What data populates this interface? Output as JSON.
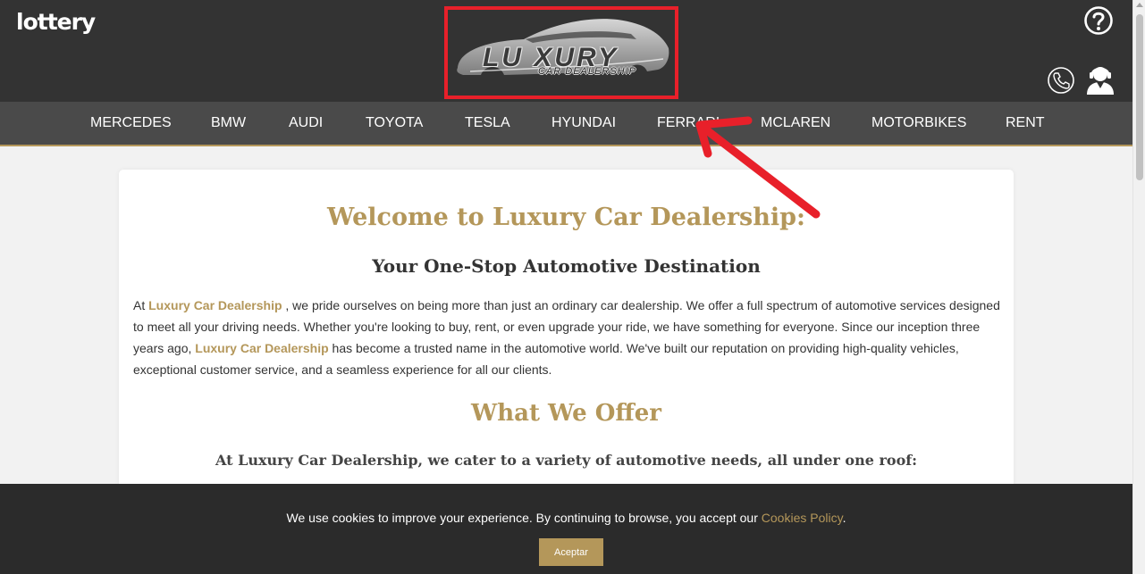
{
  "header": {
    "brand": "lottery",
    "logo": {
      "word": "LU XURY",
      "sub": "CAR DEALERSHIP"
    }
  },
  "nav": {
    "items": [
      "MERCEDES",
      "BMW",
      "AUDI",
      "TOYOTA",
      "TESLA",
      "HYUNDAI",
      "FERRARI",
      "MCLAREN",
      "MOTORBIKES",
      "RENT"
    ]
  },
  "content": {
    "welcome": "Welcome to Luxury Car Dealership:",
    "subtitle": "Your One-Stop Automotive Destination",
    "para": {
      "p1": "At ",
      "h1": "Luxury Car Dealership",
      "p2": " , we pride ourselves on being more than just an ordinary car dealership. We offer a full spectrum of automotive services designed to meet all your driving needs. Whether you're looking to buy, rent, or even upgrade your ride, we have something for everyone. Since our inception three years ago, ",
      "h2": "Luxury Car Dealership",
      "p3": " has become a trusted name in the automotive world. We've built our reputation on providing high-quality vehicles, exceptional customer service, and a seamless experience for all our clients."
    },
    "offer_title": "What We Offer",
    "cater": "At Luxury Car Dealership, we cater to a variety of automotive needs, all under one roof:"
  },
  "cookie": {
    "text": "We use cookies to improve your experience. By continuing to browse, you accept our ",
    "link": "Cookies Policy",
    "period": ".",
    "button": "Aceptar"
  },
  "icons": {
    "help": "help-circle-icon",
    "phone": "phone-icon",
    "agent": "support-agent-icon"
  },
  "colors": {
    "header_bg": "#333333",
    "nav_bg": "#4a4a4a",
    "accent_gold": "#b4975a",
    "annotation_red": "#e8202a",
    "cookie_bg": "#2b2b2b"
  }
}
